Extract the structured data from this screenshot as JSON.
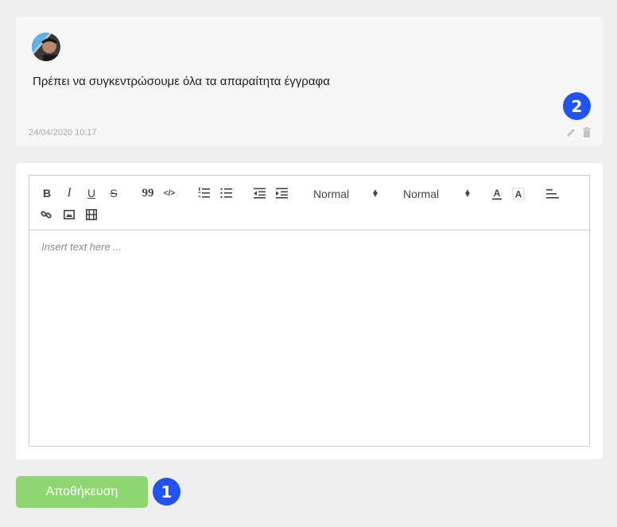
{
  "comment": {
    "text": "Πρέπει να συγκεντρώσουμε όλα τα απαραίτητα έγγραφα",
    "date": "24/04/2020 10:17",
    "icons": [
      "avatar",
      "pencil-icon",
      "trash-icon"
    ]
  },
  "badges": {
    "edit_badge": "2",
    "save_badge": "1"
  },
  "toolbar": {
    "bold": "B",
    "italic": "I",
    "underline": "U",
    "strike": "S",
    "blockquote": "99",
    "code": "</>",
    "header_picker": "Normal",
    "size_picker": "Normal",
    "icons": [
      "bold-icon",
      "italic-icon",
      "underline-icon",
      "strike-icon",
      "blockquote-icon",
      "code-icon",
      "ordered-list-icon",
      "bullet-list-icon",
      "outdent-icon",
      "indent-icon",
      "font-color-icon",
      "background-color-icon",
      "align-icon",
      "link-icon",
      "image-icon",
      "video-icon"
    ]
  },
  "editor": {
    "placeholder": "Insert text here ..."
  },
  "save_button": {
    "label": "Αποθήκευση",
    "color": "#8fd673"
  },
  "colors": {
    "badge": "#2352f4",
    "page_bg": "#efefef"
  }
}
